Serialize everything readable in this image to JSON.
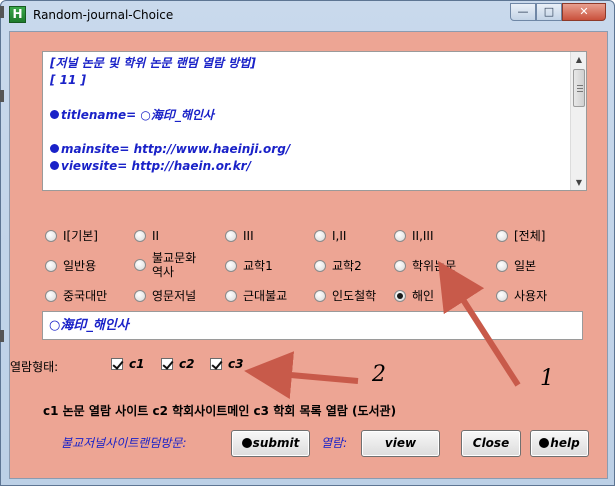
{
  "window": {
    "title": "Random-journal-Choice",
    "icon_letter": "H",
    "controls": {
      "minimize": "—",
      "maximize": "□",
      "close": "✕"
    }
  },
  "info_box": {
    "lines": [
      {
        "text": "[저널 논문 및 학위 논문 랜덤 열람 방법]",
        "bullet": false
      },
      {
        "text": "[ 11 ]",
        "bullet": false
      },
      {
        "text": "",
        "bullet": false
      },
      {
        "text": "titlename= ○海印_해인사",
        "bullet": true
      },
      {
        "text": "",
        "bullet": false
      },
      {
        "text": "mainsite= http://www.haeinji.org/",
        "bullet": true
      },
      {
        "text": "viewsite= http://haein.or.kr/",
        "bullet": true
      }
    ]
  },
  "radios": [
    {
      "label": "I[기본]",
      "checked": false
    },
    {
      "label": "II",
      "checked": false
    },
    {
      "label": "III",
      "checked": false
    },
    {
      "label": "I,II",
      "checked": false
    },
    {
      "label": "II,III",
      "checked": false
    },
    {
      "label": "[전체]",
      "checked": false
    },
    {
      "label": "일반용",
      "checked": false
    },
    {
      "label": "불교문화 역사",
      "checked": false
    },
    {
      "label": "교학1",
      "checked": false
    },
    {
      "label": "교학2",
      "checked": false
    },
    {
      "label": "학위논문",
      "checked": false
    },
    {
      "label": "일본",
      "checked": false
    },
    {
      "label": "중국대만",
      "checked": false
    },
    {
      "label": "영문저널",
      "checked": false
    },
    {
      "label": "근대불교",
      "checked": false
    },
    {
      "label": "인도철학",
      "checked": false
    },
    {
      "label": "해인",
      "checked": true
    },
    {
      "label": "사용자",
      "checked": false
    }
  ],
  "selected_field": {
    "value": "○海印_해인사"
  },
  "view_type": {
    "label": "열람형태:",
    "options": [
      {
        "label": "c1",
        "checked": true
      },
      {
        "label": "c2",
        "checked": true
      },
      {
        "label": "c3",
        "checked": true
      }
    ]
  },
  "legend": "c1  논문 열람 사이트  c2 학회사이트메인  c3 학회 목록 열람 (도서관)",
  "footer": {
    "visit_label": "불교저널사이트랜덤방문:",
    "submit_label": "submit",
    "open_label": "열람:",
    "view_label": "view",
    "close_label": "Close",
    "help_label": "help"
  },
  "annotations": {
    "one": "1",
    "two": "2",
    "arrow_color": "#c85a4a"
  }
}
